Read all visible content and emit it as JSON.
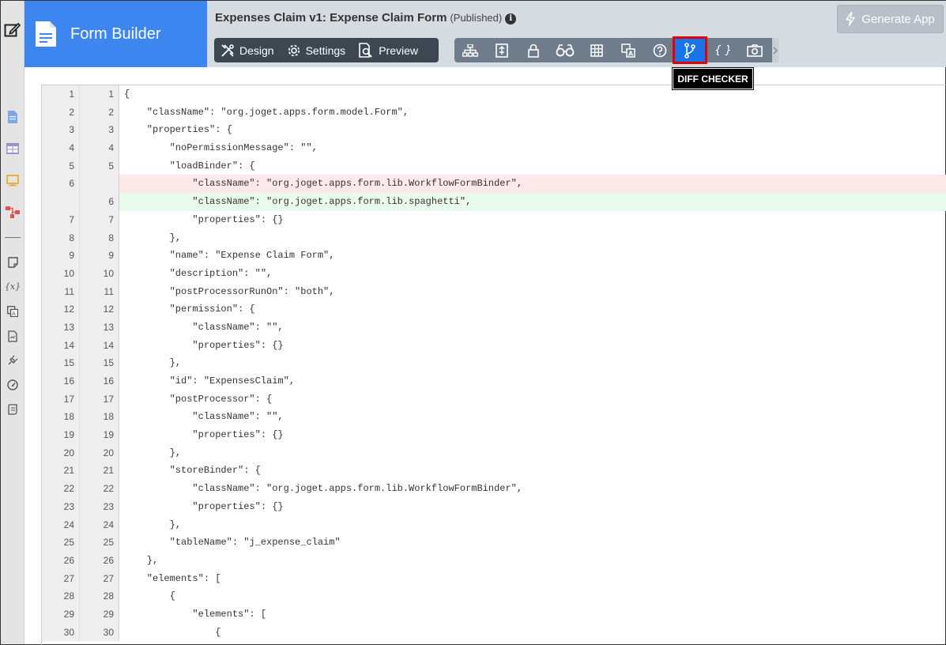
{
  "brand": {
    "name": "Form Builder"
  },
  "header": {
    "title": "Expenses Claim v1: Expense Claim Form",
    "status": "(Published)",
    "info_glyph": "i"
  },
  "modes": [
    {
      "label": "Design",
      "icon": "design-icon"
    },
    {
      "label": "Settings",
      "icon": "gear-icon"
    },
    {
      "label": "Preview",
      "icon": "preview-icon"
    }
  ],
  "tools": [
    {
      "name": "tree-structure-icon"
    },
    {
      "name": "form-properties-icon"
    },
    {
      "name": "lock-icon"
    },
    {
      "name": "binoculars-icon"
    },
    {
      "name": "grid-icon"
    },
    {
      "name": "translate-icon"
    },
    {
      "name": "help-icon"
    },
    {
      "name": "diff-checker-icon",
      "active": true
    },
    {
      "name": "json-icon",
      "glyph": "{ }"
    },
    {
      "name": "camera-icon"
    }
  ],
  "generate_button": {
    "label": "Generate App"
  },
  "tooltip": {
    "text": "DIFF CHECKER"
  },
  "colors": {
    "brand": "#3d86f0",
    "active_tool": "#1a73e8",
    "highlight_border": "#e00000",
    "deleted_line": "#fde8ea",
    "added_line": "#e9fbec"
  },
  "diff_lines": [
    {
      "left": "1",
      "right": "1",
      "text": "{",
      "type": "same"
    },
    {
      "left": "2",
      "right": "2",
      "text": "    \"className\": \"org.joget.apps.form.model.Form\",",
      "type": "same"
    },
    {
      "left": "3",
      "right": "3",
      "text": "    \"properties\": {",
      "type": "same"
    },
    {
      "left": "4",
      "right": "4",
      "text": "        \"noPermissionMessage\": \"\",",
      "type": "same"
    },
    {
      "left": "5",
      "right": "5",
      "text": "        \"loadBinder\": {",
      "type": "same"
    },
    {
      "left": "6",
      "right": "",
      "text": "            \"className\": \"org.joget.apps.form.lib.WorkflowFormBinder\",",
      "type": "del"
    },
    {
      "left": "",
      "right": "6",
      "text": "            \"className\": \"org.joget.apps.form.lib.spaghetti\",",
      "type": "add"
    },
    {
      "left": "7",
      "right": "7",
      "text": "            \"properties\": {}",
      "type": "same"
    },
    {
      "left": "8",
      "right": "8",
      "text": "        },",
      "type": "same"
    },
    {
      "left": "9",
      "right": "9",
      "text": "        \"name\": \"Expense Claim Form\",",
      "type": "same"
    },
    {
      "left": "10",
      "right": "10",
      "text": "        \"description\": \"\",",
      "type": "same"
    },
    {
      "left": "11",
      "right": "11",
      "text": "        \"postProcessorRunOn\": \"both\",",
      "type": "same"
    },
    {
      "left": "12",
      "right": "12",
      "text": "        \"permission\": {",
      "type": "same"
    },
    {
      "left": "13",
      "right": "13",
      "text": "            \"className\": \"\",",
      "type": "same"
    },
    {
      "left": "14",
      "right": "14",
      "text": "            \"properties\": {}",
      "type": "same"
    },
    {
      "left": "15",
      "right": "15",
      "text": "        },",
      "type": "same"
    },
    {
      "left": "16",
      "right": "16",
      "text": "        \"id\": \"ExpensesClaim\",",
      "type": "same"
    },
    {
      "left": "17",
      "right": "17",
      "text": "        \"postProcessor\": {",
      "type": "same"
    },
    {
      "left": "18",
      "right": "18",
      "text": "            \"className\": \"\",",
      "type": "same"
    },
    {
      "left": "19",
      "right": "19",
      "text": "            \"properties\": {}",
      "type": "same"
    },
    {
      "left": "20",
      "right": "20",
      "text": "        },",
      "type": "same"
    },
    {
      "left": "21",
      "right": "21",
      "text": "        \"storeBinder\": {",
      "type": "same"
    },
    {
      "left": "22",
      "right": "22",
      "text": "            \"className\": \"org.joget.apps.form.lib.WorkflowFormBinder\",",
      "type": "same"
    },
    {
      "left": "23",
      "right": "23",
      "text": "            \"properties\": {}",
      "type": "same"
    },
    {
      "left": "24",
      "right": "24",
      "text": "        },",
      "type": "same"
    },
    {
      "left": "25",
      "right": "25",
      "text": "        \"tableName\": \"j_expense_claim\"",
      "type": "same"
    },
    {
      "left": "26",
      "right": "26",
      "text": "    },",
      "type": "same"
    },
    {
      "left": "27",
      "right": "27",
      "text": "    \"elements\": [",
      "type": "same"
    },
    {
      "left": "28",
      "right": "28",
      "text": "        {",
      "type": "same"
    },
    {
      "left": "29",
      "right": "29",
      "text": "            \"elements\": [",
      "type": "same"
    },
    {
      "left": "30",
      "right": "30",
      "text": "                {",
      "type": "same"
    }
  ]
}
